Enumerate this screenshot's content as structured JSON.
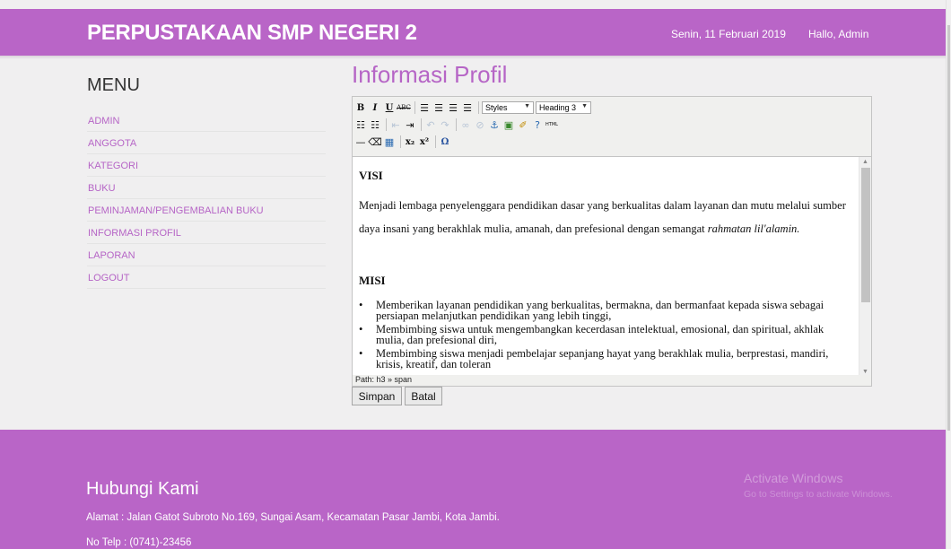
{
  "header": {
    "brand": "PERPUSTAKAAN SMP NEGERI 2",
    "date": "Senin, 11 Februari 2019",
    "greeting": "Hallo, Admin",
    "bg_color": "#b965c7"
  },
  "sidebar": {
    "title": "MENU",
    "items": [
      {
        "label": "ADMIN"
      },
      {
        "label": "ANGGOTA"
      },
      {
        "label": "KATEGORI"
      },
      {
        "label": "BUKU"
      },
      {
        "label": "PEMINJAMAN/PENGEMBALIAN BUKU"
      },
      {
        "label": "INFORMASI PROFIL"
      },
      {
        "label": "LAPORAN"
      },
      {
        "label": "LOGOUT"
      }
    ],
    "link_color": "#b665c6"
  },
  "main": {
    "title": "Informasi Profil",
    "editor": {
      "toolbar": {
        "styles_select": "Styles",
        "format_select": "Heading 3"
      },
      "content": {
        "visi_heading": "VISI",
        "visi_text": "Menjadi lembaga penyelenggara pendidikan dasar yang berkualitas dalam layanan dan mutu melalui sumber daya insani yang berakhlak mulia, amanah, dan prefesional dengan semangat",
        "visi_italic": "rahmatan lil'alamin.",
        "misi_heading": "MISI",
        "misi_items": [
          "Memberikan layanan pendidikan yang berkualitas, bermakna, dan bermanfaat kepada siswa sebagai persiapan melanjutkan pendidikan yang lebih tinggi,",
          "Membimbing siswa untuk mengembangkan kecerdasan intelektual, emosional, dan spiritual, akhlak mulia, dan prefesional diri,",
          "Membimbing siswa menjadi pembelajar sepanjang hayat yang berakhlak mulia, berprestasi, mandiri, krisis, kreatif, dan toleran"
        ]
      },
      "path": "Path: h3 » span"
    },
    "save_label": "Simpan",
    "cancel_label": "Batal"
  },
  "footer": {
    "title": "Hubungi Kami",
    "address": "Alamat : Jalan Gatot Subroto No.169, Sungai Asam, Kecamatan Pasar Jambi, Kota Jambi.",
    "phone": "No Telp : (0741)-23456",
    "watermark_title": "Activate Windows",
    "watermark_sub": "Go to Settings to activate Windows."
  }
}
